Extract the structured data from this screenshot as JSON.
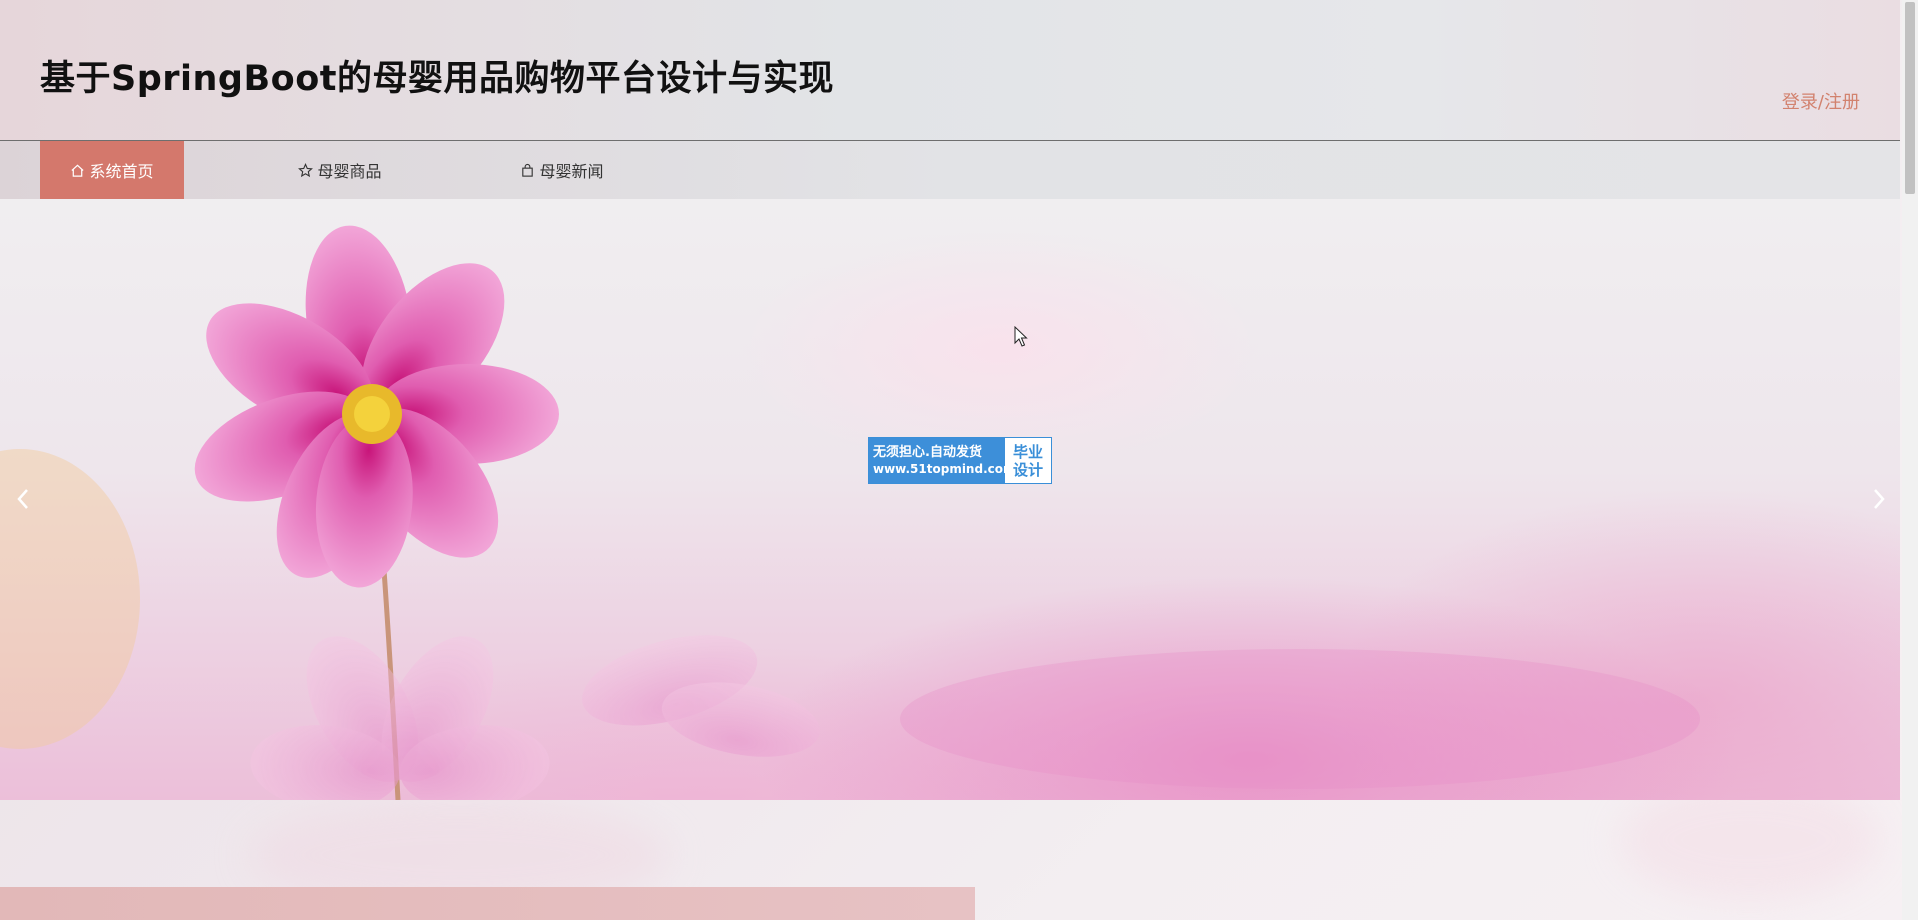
{
  "header": {
    "title": "基于SpringBoot的母婴用品购物平台设计与实现",
    "login_label": "登录/注册"
  },
  "nav": {
    "items": [
      {
        "label": "系统首页",
        "icon": "home-icon",
        "active": true
      },
      {
        "label": "母婴商品",
        "icon": "star-icon",
        "active": false
      },
      {
        "label": "母婴新闻",
        "icon": "bag-icon",
        "active": false
      }
    ]
  },
  "banner": {
    "prev_icon": "chevron-left-icon",
    "next_icon": "chevron-right-icon"
  },
  "watermark": {
    "line1": "无须担心.自动发货",
    "line2": "www.51topmind.com",
    "right_line1": "毕业",
    "right_line2": "设计"
  },
  "colors": {
    "accent": "#d4786c",
    "login": "#d2826e",
    "title": "#111111"
  }
}
